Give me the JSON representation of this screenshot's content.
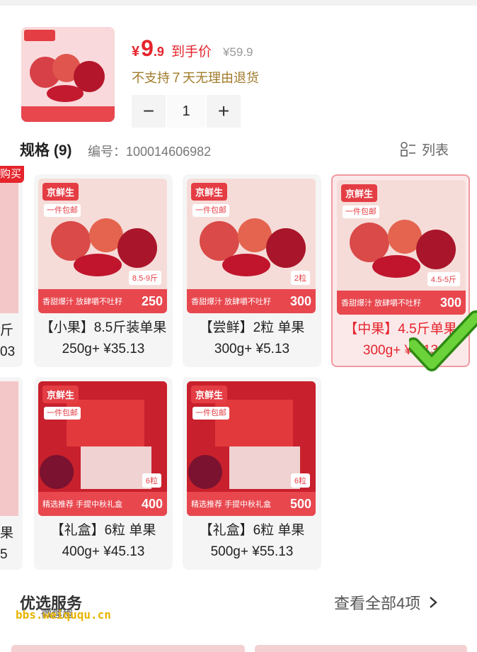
{
  "product": {
    "price_currency": "¥",
    "price_int": "9",
    "price_dec": ".9",
    "price_tag": "到手价",
    "original_price": "¥59.9",
    "return_note": "不支持７天无理由退货",
    "quantity": "1",
    "minus": "−",
    "plus": "+"
  },
  "spec": {
    "title": "规格 (9)",
    "code": "编号：100014606982",
    "list_label": "列表"
  },
  "buy_badge": "购买",
  "image_text": {
    "brand": "京鲜生",
    "mail": "一件包邮",
    "slogan": "香甜爆汁 放肆嚼不吐籽",
    "gift_slogan": "精选推荐 手提中秋礼盒",
    "single": "单果"
  },
  "partial_left": {
    "row1": [
      "斤",
      "03"
    ],
    "row2": [
      "果",
      "5"
    ]
  },
  "cards": [
    {
      "label": "【小果】8.5斤装单果250g+ ¥35.13",
      "weight": "8.5-9斤",
      "grams": "250",
      "selected": false
    },
    {
      "label": "【尝鲜】2粒 单果300g+ ¥5.13",
      "weight": "2粒",
      "grams": "300",
      "selected": false
    },
    {
      "label": "【中果】4.5斤单果300g+ ¥5.13",
      "weight": "4.5-5斤",
      "grams": "300",
      "selected": true
    },
    {
      "label": "【礼盒】6粒 单果400g+ ¥45.13",
      "weight": "6粒",
      "grams": "400",
      "selected": false
    },
    {
      "label": "【礼盒】6粒 单果500g+ ¥55.13",
      "weight": "6粒",
      "grams": "500",
      "selected": false
    }
  ],
  "services": {
    "title": "优选服务",
    "more": "查看全部4项"
  },
  "watermark": {
    "text": "bbs.weiququ.cn",
    "logo": "微趣趣"
  },
  "colors": {
    "accent": "#e5242c",
    "check": "#52b62a"
  }
}
